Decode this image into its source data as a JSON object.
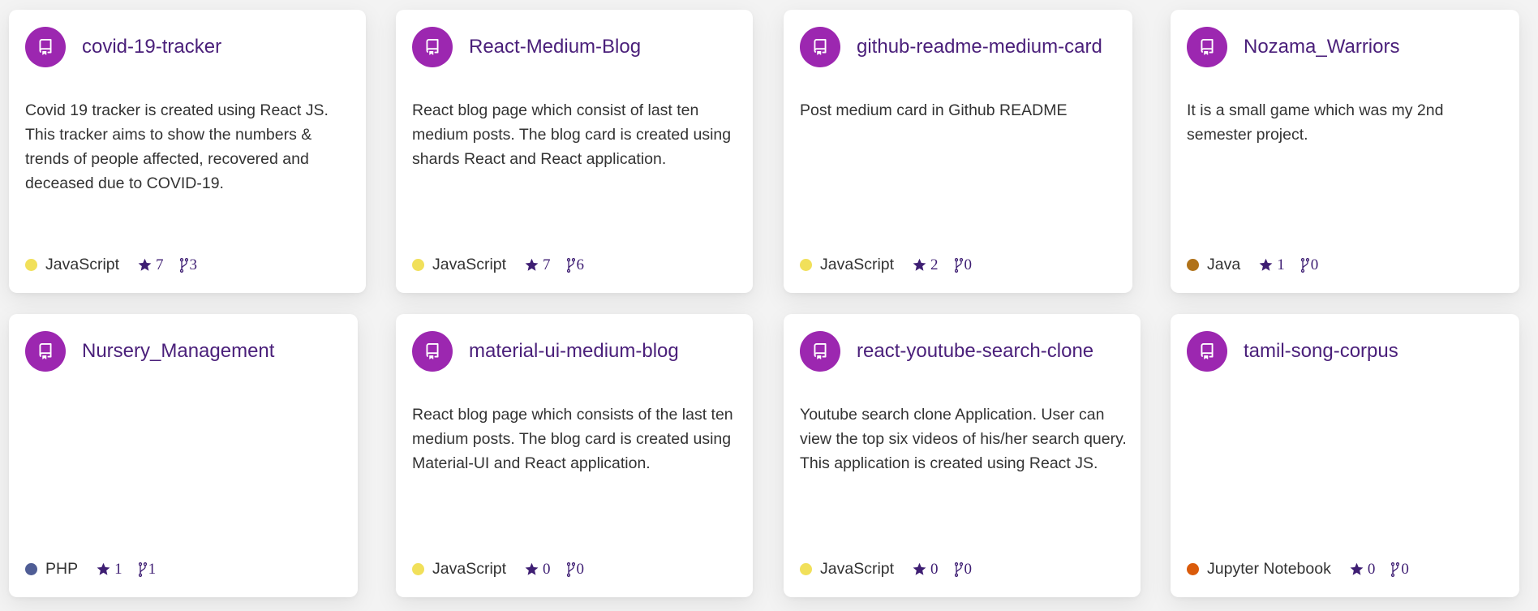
{
  "colors": {
    "icon_bg": "#9c27b0",
    "title": "#4a1f7a",
    "stat": "#3e1e73"
  },
  "repos": [
    {
      "name": "covid-19-tracker",
      "description": "Covid 19 tracker is created using React JS. This tracker aims to show the numbers & trends of people affected, recovered and deceased due to COVID-19.",
      "language": "JavaScript",
      "language_color": "#f1e05a",
      "stars": "7",
      "forks": "3",
      "icon": "repo-book-icon"
    },
    {
      "name": "React-Medium-Blog",
      "description": "React blog page which consist of last ten medium posts. The blog card is created using shards React and React application.",
      "language": "JavaScript",
      "language_color": "#f1e05a",
      "stars": "7",
      "forks": "6",
      "icon": "repo-book-icon"
    },
    {
      "name": "github-readme-medium-card",
      "description": "Post medium card in Github README",
      "language": "JavaScript",
      "language_color": "#f1e05a",
      "stars": "2",
      "forks": "0",
      "icon": "repo-book-icon"
    },
    {
      "name": "Nozama_Warriors",
      "description": "It is a small game which was my 2nd semester project.",
      "language": "Java",
      "language_color": "#b07219",
      "stars": "1",
      "forks": "0",
      "icon": "repo-book-icon"
    },
    {
      "name": "Nursery_Management",
      "description": "",
      "language": "PHP",
      "language_color": "#4f5d95",
      "stars": "1",
      "forks": "1",
      "icon": "repo-book-icon"
    },
    {
      "name": "material-ui-medium-blog",
      "description": "React blog page which consists of the last ten medium posts. The blog card is created using Material-UI and React application.",
      "language": "JavaScript",
      "language_color": "#f1e05a",
      "stars": "0",
      "forks": "0",
      "icon": "repo-book-icon"
    },
    {
      "name": "react-youtube-search-clone",
      "description": "Youtube search clone Application. User can view the top six videos of his/her search query. This application is created using React JS.",
      "language": "JavaScript",
      "language_color": "#f1e05a",
      "stars": "0",
      "forks": "0",
      "icon": "repo-book-icon"
    },
    {
      "name": "tamil-song-corpus",
      "description": "",
      "language": "Jupyter Notebook",
      "language_color": "#da5b0b",
      "stars": "0",
      "forks": "0",
      "icon": "repo-book-icon"
    }
  ]
}
